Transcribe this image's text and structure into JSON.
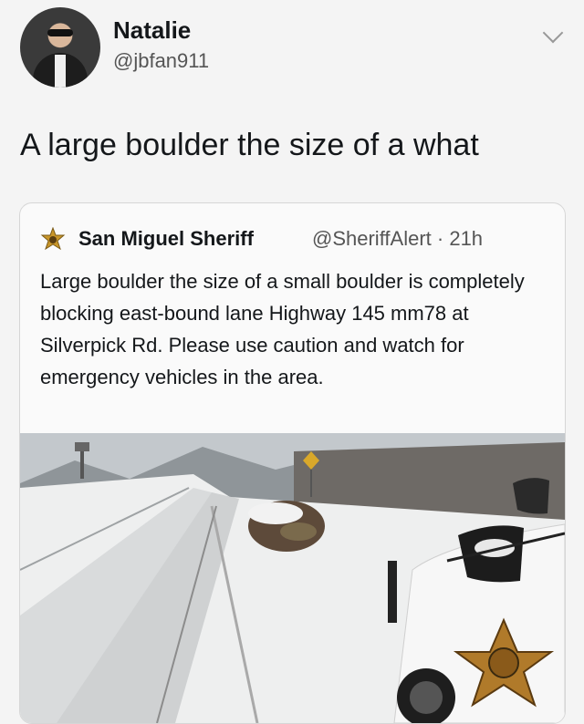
{
  "post": {
    "author_name": "Natalie",
    "author_handle": "@jbfan911",
    "text": "A large boulder the size of a what"
  },
  "quoted": {
    "author_name": "San Miguel Sheriff",
    "author_handle": "@SheriffAlert",
    "time": "21h",
    "text": "Large boulder the size of a small boulder is completely blocking east-bound lane Highway 145 mm78 at Silverpick Rd. Please use caution and watch for emergency vehicles in the area."
  },
  "icons": {
    "menu": "chevron-down-icon",
    "badge": "sheriff-star-icon"
  },
  "colors": {
    "background": "#f4f4f4",
    "text": "#14171a",
    "muted": "#555555",
    "badge": "#c8962a"
  }
}
